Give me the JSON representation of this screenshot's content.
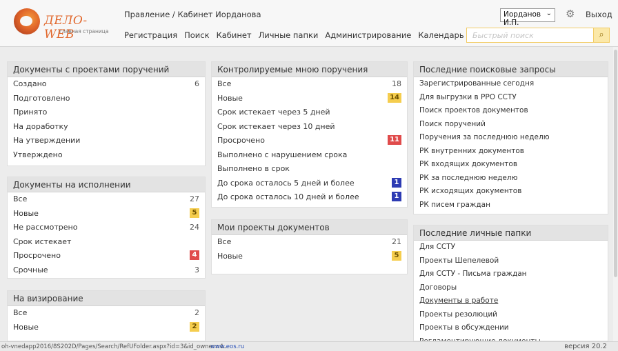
{
  "header": {
    "logo_text": "ДЕЛО-WEB",
    "logo_sub": "главная страница",
    "breadcrumb": "Правление / Кабинет Иорданова",
    "user": "Иорданов И.П.",
    "exit": "Выход",
    "nav": [
      "Регистрация",
      "Поиск",
      "Кабинет",
      "Личные папки",
      "Администрирование",
      "Календарь"
    ],
    "search_placeholder": "Быстрый поиск"
  },
  "panels": {
    "proj_orders": {
      "title": "Документы с проектами поручений",
      "rows": [
        {
          "label": "Создано",
          "value": "6"
        },
        {
          "label": "Подготовлено",
          "value": ""
        },
        {
          "label": "Принято",
          "value": ""
        },
        {
          "label": "На доработку",
          "value": ""
        },
        {
          "label": "На утверждении",
          "value": ""
        },
        {
          "label": "Утверждено",
          "value": ""
        }
      ]
    },
    "in_execution": {
      "title": "Документы на исполнении",
      "rows": [
        {
          "label": "Все",
          "value": "27"
        },
        {
          "label": "Новые",
          "value": "5",
          "badge": "yellow"
        },
        {
          "label": "Не рассмотрено",
          "value": "24"
        },
        {
          "label": "Срок истекает",
          "value": ""
        },
        {
          "label": "Просрочено",
          "value": "4",
          "badge": "red"
        },
        {
          "label": "Срочные",
          "value": "3"
        }
      ]
    },
    "visa": {
      "title": "На визирование",
      "rows": [
        {
          "label": "Все",
          "value": "2"
        },
        {
          "label": "Новые",
          "value": "2",
          "badge": "yellow"
        }
      ]
    },
    "controlled": {
      "title": "Контролируемые мною поручения",
      "rows": [
        {
          "label": "Все",
          "value": "18"
        },
        {
          "label": "Новые",
          "value": "14",
          "badge": "yellow"
        },
        {
          "label": "Срок истекает через 5 дней",
          "value": ""
        },
        {
          "label": "Срок истекает через 10 дней",
          "value": ""
        },
        {
          "label": "Просрочено",
          "value": "11",
          "badge": "red"
        },
        {
          "label": "Выполнено с нарушением срока",
          "value": ""
        },
        {
          "label": "Выполнено в срок",
          "value": ""
        },
        {
          "label": "До срока осталось 5 дней и более",
          "value": "1",
          "badge": "blue"
        },
        {
          "label": "До срока осталось 10 дней и более",
          "value": "1",
          "badge": "blue"
        }
      ]
    },
    "my_projects": {
      "title": "Мои проекты документов",
      "rows": [
        {
          "label": "Все",
          "value": "21"
        },
        {
          "label": "Новые",
          "value": "5",
          "badge": "yellow"
        }
      ]
    },
    "searches": {
      "title": "Последние поисковые запросы",
      "items": [
        "Зарегистрированные сегодня",
        "Для выгрузки в РРО ССТУ",
        "Поиск проектов документов",
        "Поиск поручений",
        "Поручения за последнюю неделю",
        "РК внутренних документов",
        "РК входящих документов",
        "РК за последнюю неделю",
        "РК исходящих документов",
        "РК писем граждан"
      ]
    },
    "folders": {
      "title": "Последние личные папки",
      "items": [
        "Для ССТУ",
        "Проекты Шепелевой",
        "Для ССТУ - Письма граждан",
        "Договоры",
        "Документы в работе",
        "Проекты резолюций",
        "Проекты в обсуждении",
        "Регламентирующие документы"
      ]
    }
  },
  "status": {
    "url": "oh-vnedapp2016/8S202D/Pages/Search/RefUFolder.aspx?id=3&id_owner=4...",
    "link": "www.eos.ru",
    "version": "версия 20.2"
  }
}
